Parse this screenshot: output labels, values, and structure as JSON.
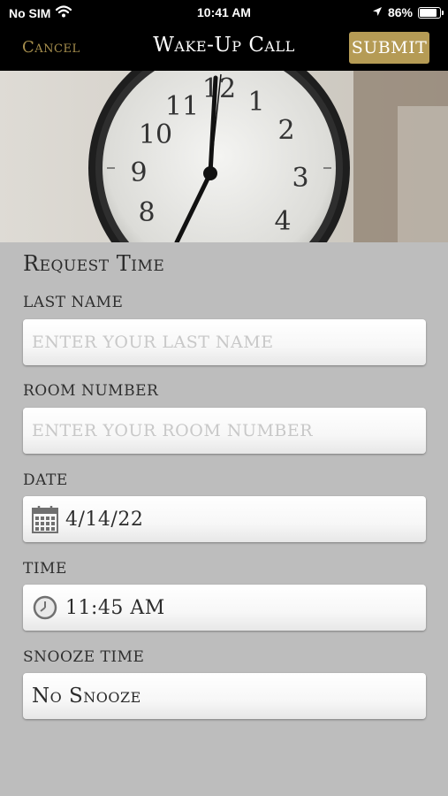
{
  "status_bar": {
    "carrier": "No SIM",
    "time": "10:41 AM",
    "battery": "86%",
    "battery_level": 0.86,
    "icons": [
      "wifi-icon",
      "location-arrow-icon",
      "battery-icon"
    ]
  },
  "nav": {
    "cancel_label": "Cancel",
    "title": "Wake-Up Call",
    "submit_label": "SUBMIT"
  },
  "colors": {
    "nav_background": "#000000",
    "accent_gold": "#b59b55",
    "cancel_gold": "#a8904e",
    "page_background": "#bdbdbd"
  },
  "hero": {
    "icon": "alarm-clock-photo",
    "clock_numbers": [
      "12",
      "1",
      "2",
      "3",
      "4",
      "8",
      "9",
      "10",
      "11"
    ]
  },
  "form": {
    "section_title": "Request Time",
    "last_name": {
      "label": "LAST NAME",
      "placeholder": "ENTER YOUR LAST NAME",
      "value": ""
    },
    "room_number": {
      "label": "ROOM NUMBER",
      "placeholder": "ENTER YOUR ROOM NUMBER",
      "value": ""
    },
    "date": {
      "label": "DATE",
      "value": "4/14/22",
      "icon": "calendar-icon"
    },
    "time": {
      "label": "TIME",
      "value": "11:45 AM",
      "icon": "clock-icon"
    },
    "snooze_time": {
      "label": "SNOOZE TIME",
      "value": "No Snooze"
    }
  }
}
